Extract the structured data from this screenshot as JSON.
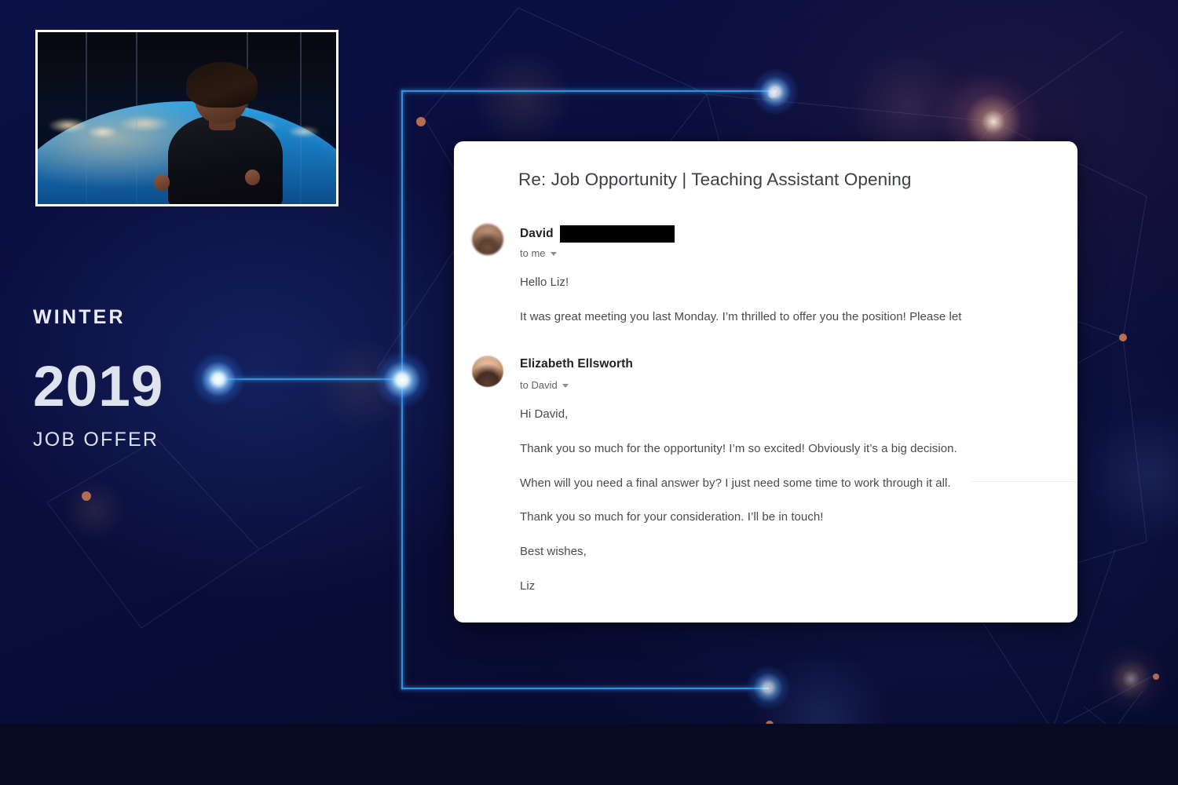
{
  "slide": {
    "caption": {
      "season": "WINTER",
      "year": "2019",
      "event": "JOB OFFER"
    },
    "thumbnail": {
      "alt": "Speaker on stage in front of an Earth-from-space backdrop"
    },
    "accent_color": "#2f93e0",
    "background_color": "#0a0e3c"
  },
  "email": {
    "subject": "Re: Job Opportunity | Teaching Assistant Opening",
    "messages": [
      {
        "sender": "David",
        "sender_redacted": true,
        "recipient_label": "to me",
        "avatar_name": "david-avatar",
        "paragraphs": [
          "Hello Liz!",
          "It was great meeting you last Monday. I’m thrilled to offer you the position! Please let"
        ]
      },
      {
        "sender": "Elizabeth Ellsworth",
        "sender_redacted": false,
        "recipient_label": "to David",
        "avatar_name": "elizabeth-avatar",
        "paragraphs": [
          "Hi David,",
          "Thank you so much for the opportunity! I’m so excited! Obviously it’s a big decision.",
          "When will you need a final answer by? I just need some time to work through it all.",
          "Thank you so much for your consideration. I’ll be in touch!",
          "Best wishes,",
          "Liz"
        ]
      }
    ]
  }
}
